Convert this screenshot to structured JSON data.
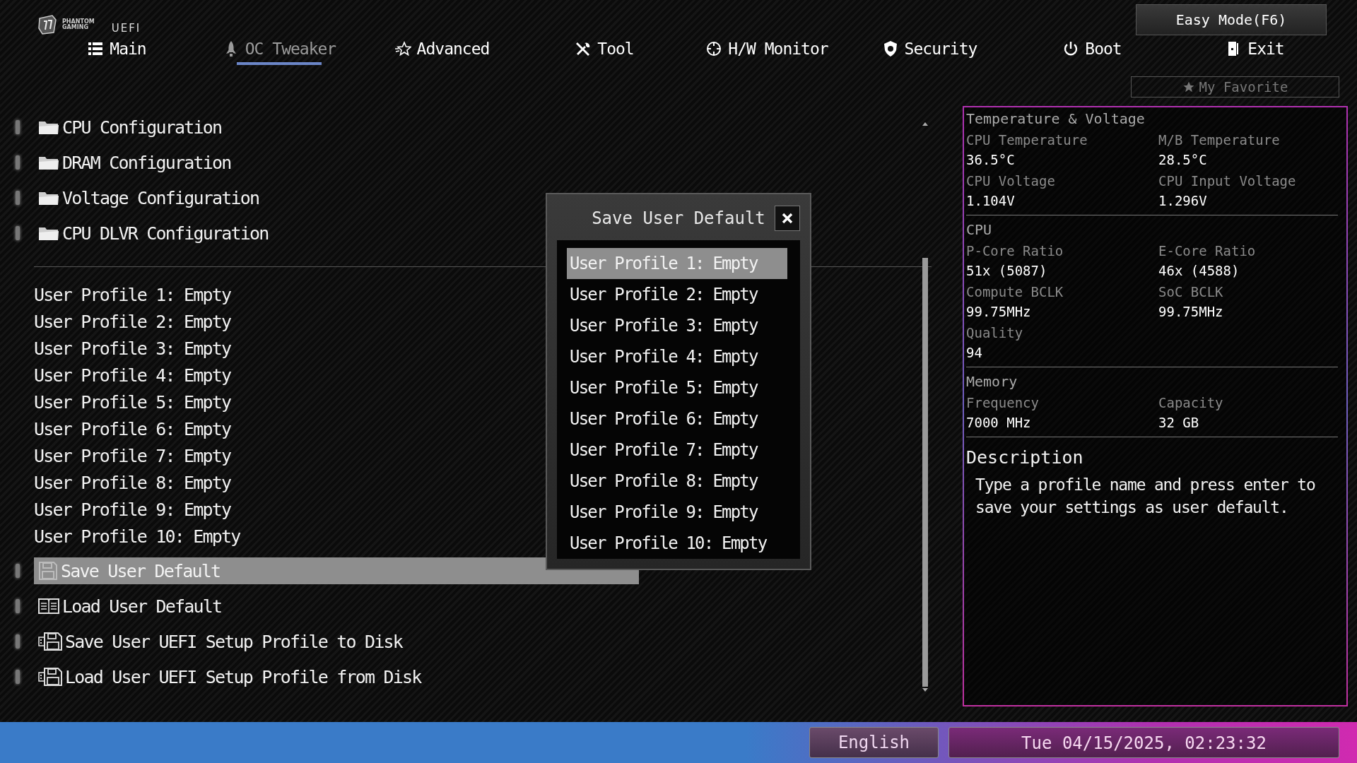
{
  "header": {
    "logo_lines": [
      "PHANTOM",
      "GAMING"
    ],
    "uefi": "UEFI",
    "easy_mode": "Easy Mode(F6)",
    "favorite": "My Favorite"
  },
  "tabs": [
    {
      "label": "Main",
      "selected": false
    },
    {
      "label": "OC Tweaker",
      "selected": true
    },
    {
      "label": "Advanced",
      "selected": false
    },
    {
      "label": "Tool",
      "selected": false
    },
    {
      "label": "H/W Monitor",
      "selected": false
    },
    {
      "label": "Security",
      "selected": false
    },
    {
      "label": "Boot",
      "selected": false
    },
    {
      "label": "Exit",
      "selected": false
    }
  ],
  "menu": {
    "items": [
      {
        "kind": "folder",
        "label": "CPU Configuration",
        "selected": false
      },
      {
        "kind": "folder",
        "label": "DRAM Configuration",
        "selected": false
      },
      {
        "kind": "folder",
        "label": "Voltage Configuration",
        "selected": false
      },
      {
        "kind": "folder",
        "label": "CPU DLVR Configuration",
        "selected": false
      },
      {
        "kind": "divider"
      },
      {
        "kind": "profile",
        "label": "User Profile 1: Empty",
        "selected": false
      },
      {
        "kind": "profile",
        "label": "User Profile 2: Empty",
        "selected": false
      },
      {
        "kind": "profile",
        "label": "User Profile 3: Empty",
        "selected": false
      },
      {
        "kind": "profile",
        "label": "User Profile 4: Empty",
        "selected": false
      },
      {
        "kind": "profile",
        "label": "User Profile 5: Empty",
        "selected": false
      },
      {
        "kind": "profile",
        "label": "User Profile 6: Empty",
        "selected": false
      },
      {
        "kind": "profile",
        "label": "User Profile 7: Empty",
        "selected": false
      },
      {
        "kind": "profile",
        "label": "User Profile 8: Empty",
        "selected": false
      },
      {
        "kind": "profile",
        "label": "User Profile 9: Empty",
        "selected": false
      },
      {
        "kind": "profile",
        "label": "User Profile 10: Empty",
        "selected": false
      },
      {
        "kind": "floppy",
        "label": "Save User Default",
        "selected": true
      },
      {
        "kind": "book",
        "label": "Load User Default",
        "selected": false
      },
      {
        "kind": "usb",
        "label": "Save User UEFI Setup Profile to Disk",
        "selected": false
      },
      {
        "kind": "usb",
        "label": "Load User UEFI Setup Profile from Disk",
        "selected": false
      }
    ]
  },
  "dialog": {
    "title": "Save User Default",
    "items": [
      {
        "label": "User Profile 1: Empty",
        "selected": true
      },
      {
        "label": "User Profile 2: Empty",
        "selected": false
      },
      {
        "label": "User Profile 3: Empty",
        "selected": false
      },
      {
        "label": "User Profile 4: Empty",
        "selected": false
      },
      {
        "label": "User Profile 5: Empty",
        "selected": false
      },
      {
        "label": "User Profile 6: Empty",
        "selected": false
      },
      {
        "label": "User Profile 7: Empty",
        "selected": false
      },
      {
        "label": "User Profile 8: Empty",
        "selected": false
      },
      {
        "label": "User Profile 9: Empty",
        "selected": false
      },
      {
        "label": "User Profile 10: Empty",
        "selected": false
      }
    ]
  },
  "monitor": {
    "sections": [
      {
        "title": "Temperature & Voltage",
        "fields": [
          {
            "label": "CPU Temperature",
            "value": "36.5°C"
          },
          {
            "label": "M/B Temperature",
            "value": "28.5°C"
          },
          {
            "label": "CPU Voltage",
            "value": "1.104V"
          },
          {
            "label": "CPU Input Voltage",
            "value": "1.296V"
          }
        ]
      },
      {
        "title": "CPU",
        "fields": [
          {
            "label": "P-Core Ratio",
            "value": "51x (5087)"
          },
          {
            "label": "E-Core Ratio",
            "value": "46x (4588)"
          },
          {
            "label": "Compute BCLK",
            "value": "99.75MHz"
          },
          {
            "label": "SoC BCLK",
            "value": "99.75MHz"
          },
          {
            "label": "Quality",
            "value": "94"
          }
        ]
      },
      {
        "title": "Memory",
        "fields": [
          {
            "label": "Frequency",
            "value": "7000 MHz"
          },
          {
            "label": "Capacity",
            "value": "32 GB"
          }
        ]
      }
    ],
    "description": {
      "title": "Description",
      "text": "Type a profile name and press enter to save your settings as user default."
    }
  },
  "status_bar": {
    "language": "English",
    "datetime": "Tue 04/15/2025, 02:23:32"
  }
}
